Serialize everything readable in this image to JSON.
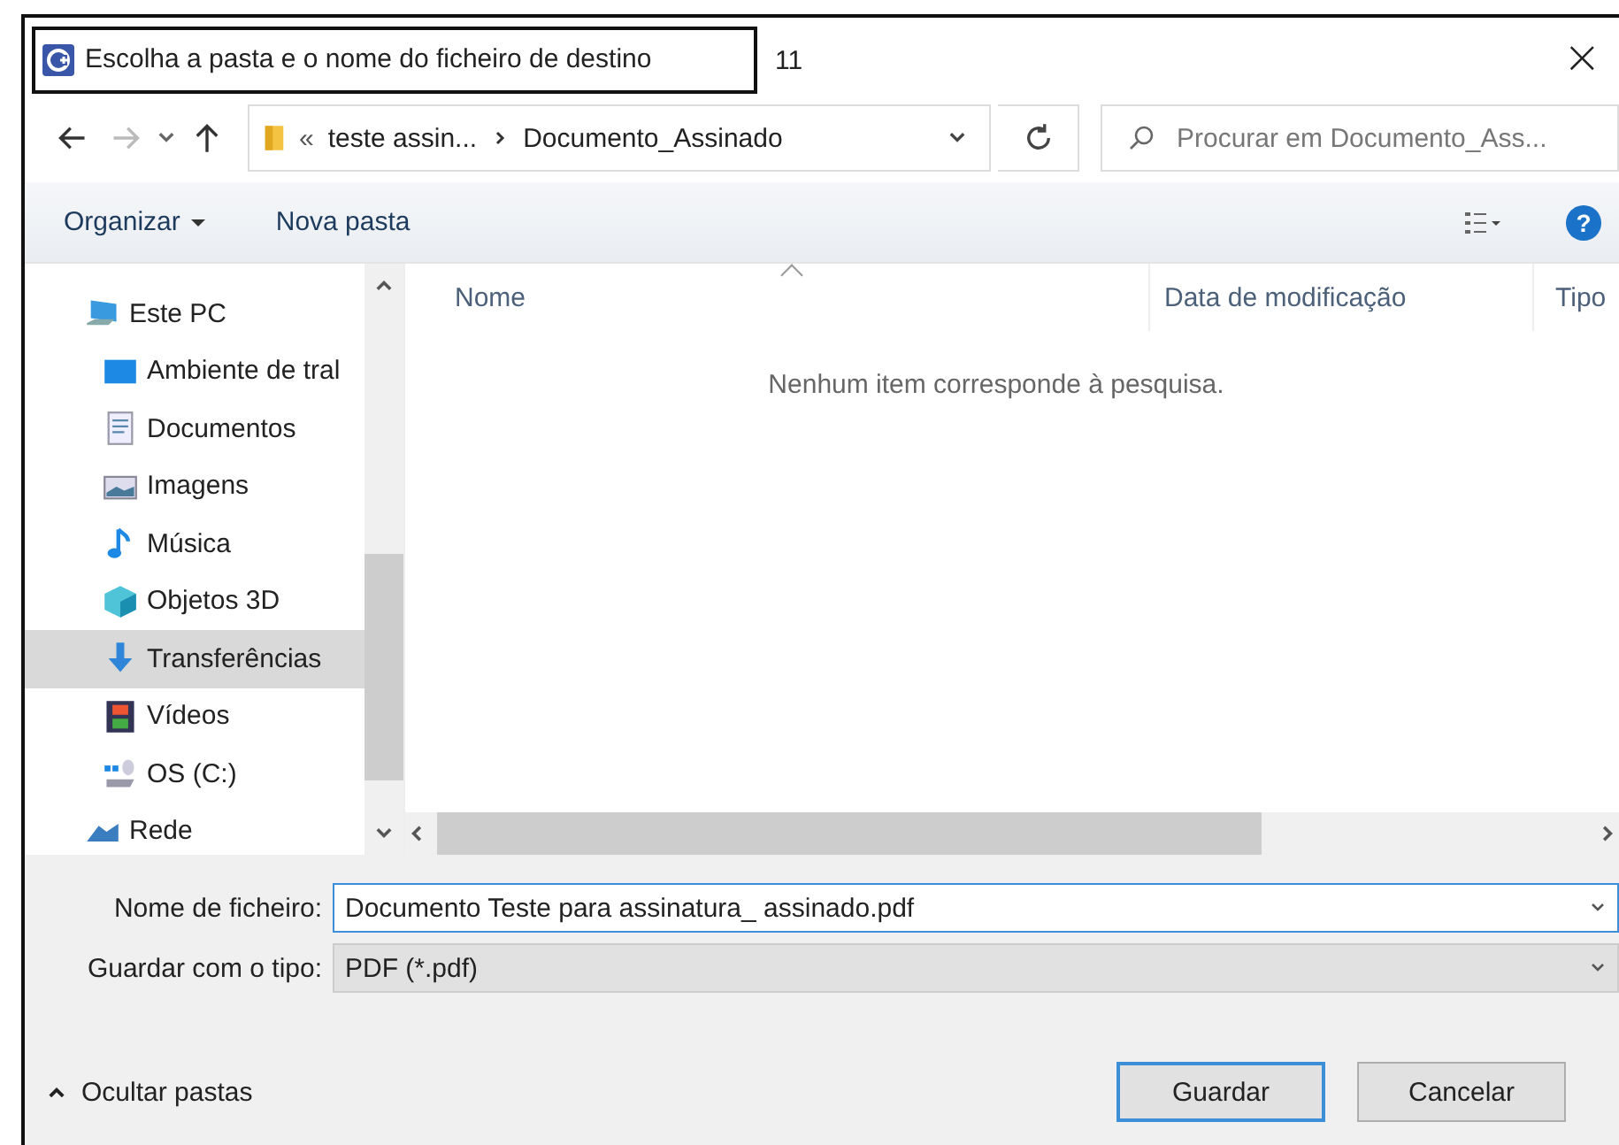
{
  "window": {
    "title": "Escolha a pasta e o nome do ficheiro de destino",
    "annotation": "11",
    "close": "×"
  },
  "navigation": {
    "breadcrumb": [
      {
        "label": "«",
        "kind": "overflow"
      },
      {
        "label": "teste assin...",
        "kind": "folder"
      },
      {
        "label": "Documento_Assinado",
        "kind": "folder"
      }
    ],
    "search": {
      "placeholder": "Procurar em Documento_Ass..."
    }
  },
  "toolbar": {
    "buttons": [
      {
        "label": "Organizar",
        "dropdown": true
      },
      {
        "label": "Nova pasta",
        "dropdown": false
      }
    ],
    "help": "?"
  },
  "sidebar": {
    "items": [
      {
        "label": "Este PC",
        "selected": false,
        "children": [
          {
            "label": "Ambiente de tral",
            "selected": false
          },
          {
            "label": "Documentos",
            "selected": false
          },
          {
            "label": "Imagens",
            "selected": false
          },
          {
            "label": "Música",
            "selected": false
          },
          {
            "label": "Objetos 3D",
            "selected": false
          },
          {
            "label": "Transferências",
            "selected": true
          },
          {
            "label": "Vídeos",
            "selected": false
          },
          {
            "label": "OS (C:)",
            "selected": false
          }
        ]
      },
      {
        "label": "Rede",
        "selected": false
      }
    ]
  },
  "table": {
    "columns": [
      "Nome",
      "Data de modificação",
      "Tipo"
    ],
    "empty_message": "Nenhum item corresponde à pesquisa."
  },
  "form": {
    "fields": [
      {
        "label": "Nome de ficheiro:",
        "value": "Documento Teste para assinatura_ assinado.pdf",
        "kind": "input"
      },
      {
        "label": "Guardar com o tipo:",
        "value": "PDF (*.pdf)",
        "kind": "select"
      }
    ]
  },
  "footer": {
    "toggle": "Ocultar pastas",
    "buttons": [
      {
        "label": "Guardar",
        "default": true
      },
      {
        "label": "Cancelar",
        "default": false
      }
    ]
  }
}
